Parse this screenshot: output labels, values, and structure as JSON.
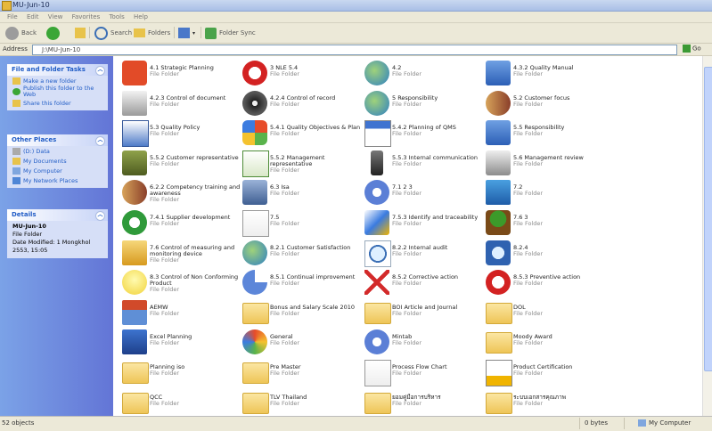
{
  "window": {
    "title": "MU-Jun-10"
  },
  "menu": [
    "File",
    "Edit",
    "View",
    "Favorites",
    "Tools",
    "Help"
  ],
  "toolbar": {
    "back": "Back",
    "search": "Search",
    "folders": "Folders",
    "sync": "Folder Sync"
  },
  "address": {
    "label": "Address",
    "value": "J:\\MU-Jun-10",
    "go": "Go"
  },
  "tasks": {
    "title": "File and Folder Tasks",
    "items": [
      "Make a new folder",
      "Publish this folder to the Web",
      "Share this folder"
    ]
  },
  "places": {
    "title": "Other Places",
    "items": [
      "(D:) Data",
      "My Documents",
      "My Computer",
      "My Network Places"
    ]
  },
  "details": {
    "title": "Details",
    "name": "MU-Jun-10",
    "type": "File Folder",
    "modified": "Date Modified: 1 Mongkhol 2553, 15:05"
  },
  "files": [
    {
      "name": "4.1 Strategic Planning",
      "type": "File Folder",
      "icon": "power-icon"
    },
    {
      "name": "3 NLE 5.4",
      "type": "File Folder",
      "icon": "no-entry-icon"
    },
    {
      "name": "4.2",
      "type": "File Folder",
      "icon": "globe-icon"
    },
    {
      "name": "4.3.2 Quality Manual",
      "type": "File Folder",
      "icon": "network-icon"
    },
    {
      "name": "4.2.3 Control of document",
      "type": "File Folder",
      "icon": "printer-icon"
    },
    {
      "name": "4.2.4 Control of record",
      "type": "File Folder",
      "icon": "cd-icon"
    },
    {
      "name": "5 Responsibility",
      "type": "File Folder",
      "icon": "globe-icon"
    },
    {
      "name": "5.2 Customer focus",
      "type": "File Folder",
      "icon": "people-icon"
    },
    {
      "name": "5.3 Quality Policy",
      "type": "File Folder",
      "icon": "checklist-icon"
    },
    {
      "name": "5.4.1 Quality Objectives & Plan",
      "type": "File Folder",
      "icon": "windows-icon"
    },
    {
      "name": "5.4.2 Planning of QMS",
      "type": "File Folder",
      "icon": "calendar-icon"
    },
    {
      "name": "5.5 Responsibility",
      "type": "File Folder",
      "icon": "network-icon"
    },
    {
      "name": "5.5.2 Customer representative",
      "type": "File Folder",
      "icon": "pda-icon"
    },
    {
      "name": "5.5.2 Management representative",
      "type": "File Folder",
      "icon": "mail-check-icon"
    },
    {
      "name": "5.5.3 Internal communication",
      "type": "File Folder",
      "icon": "phone-icon"
    },
    {
      "name": "5.6 Management review",
      "type": "File Folder",
      "icon": "drive-icon"
    },
    {
      "name": "6.2.2 Competency training and awareness",
      "type": "File Folder",
      "icon": "people-icon"
    },
    {
      "name": "6.3 Isa",
      "type": "File Folder",
      "icon": "camera-icon"
    },
    {
      "name": "7.1 2 3",
      "type": "File Folder",
      "icon": "gear-icon"
    },
    {
      "name": "7.2",
      "type": "File Folder",
      "icon": "monitor-icon"
    },
    {
      "name": "7.4.1 Supplier development",
      "type": "File Folder",
      "icon": "accessibility-icon"
    },
    {
      "name": "7.5",
      "type": "File Folder",
      "icon": "document-icon"
    },
    {
      "name": "7.5.3 Identify and traceability",
      "type": "File Folder",
      "icon": "paint-icon"
    },
    {
      "name": "7.6 3",
      "type": "File Folder",
      "icon": "tree-icon"
    },
    {
      "name": "7.6 Control of measuring and monitoring device",
      "type": "File Folder",
      "icon": "folder-open-icon"
    },
    {
      "name": "8.2.1 Customer Satisfaction",
      "type": "File Folder",
      "icon": "globe-icon"
    },
    {
      "name": "8.2.2 Internal audit",
      "type": "File Folder",
      "icon": "search-icon"
    },
    {
      "name": "8.2.4",
      "type": "File Folder",
      "icon": "search-folder-icon"
    },
    {
      "name": "8.3 Control of Non Conforming Product",
      "type": "File Folder",
      "icon": "bulb-icon"
    },
    {
      "name": "8.5.1 Continual improvement",
      "type": "File Folder",
      "icon": "pie-icon"
    },
    {
      "name": "8.5.2 Corrective action",
      "type": "File Folder",
      "icon": "x-icon"
    },
    {
      "name": "8.5.3 Preventive action",
      "type": "File Folder",
      "icon": "no-entry-icon"
    },
    {
      "name": "AEMW",
      "type": "File Folder",
      "icon": "house-icon"
    },
    {
      "name": "Bonus and Salary Scale 2010",
      "type": "File Folder",
      "icon": "folder-icon"
    },
    {
      "name": "BOI Article and Journal",
      "type": "File Folder",
      "icon": "folder-icon"
    },
    {
      "name": "DOL",
      "type": "File Folder",
      "icon": "folder-icon"
    },
    {
      "name": "Excel Planning",
      "type": "File Folder",
      "icon": "app-icon"
    },
    {
      "name": "General",
      "type": "File Folder",
      "icon": "disc-icon"
    },
    {
      "name": "Mintab",
      "type": "File Folder",
      "icon": "gear-icon"
    },
    {
      "name": "Moody Award",
      "type": "File Folder",
      "icon": "folder-icon"
    },
    {
      "name": "Planning iso",
      "type": "File Folder",
      "icon": "folder-icon"
    },
    {
      "name": "Pre Master",
      "type": "File Folder",
      "icon": "folder-icon"
    },
    {
      "name": "Process Flow Chart",
      "type": "File Folder",
      "icon": "document-icon"
    },
    {
      "name": "Product Certification",
      "type": "File Folder",
      "icon": "certificate-icon"
    },
    {
      "name": "QCC",
      "type": "File Folder",
      "icon": "folder-icon"
    },
    {
      "name": "TLV Thailand",
      "type": "File Folder",
      "icon": "folder-icon"
    },
    {
      "name": "ยอมคู่มือการบริหาร",
      "type": "File Folder",
      "icon": "folder-icon"
    },
    {
      "name": "ระบบเอกสารคุณภาพ",
      "type": "File Folder",
      "icon": "folder-icon"
    }
  ],
  "status": {
    "count": "52 objects",
    "size": "0 bytes",
    "location": "My Computer"
  }
}
